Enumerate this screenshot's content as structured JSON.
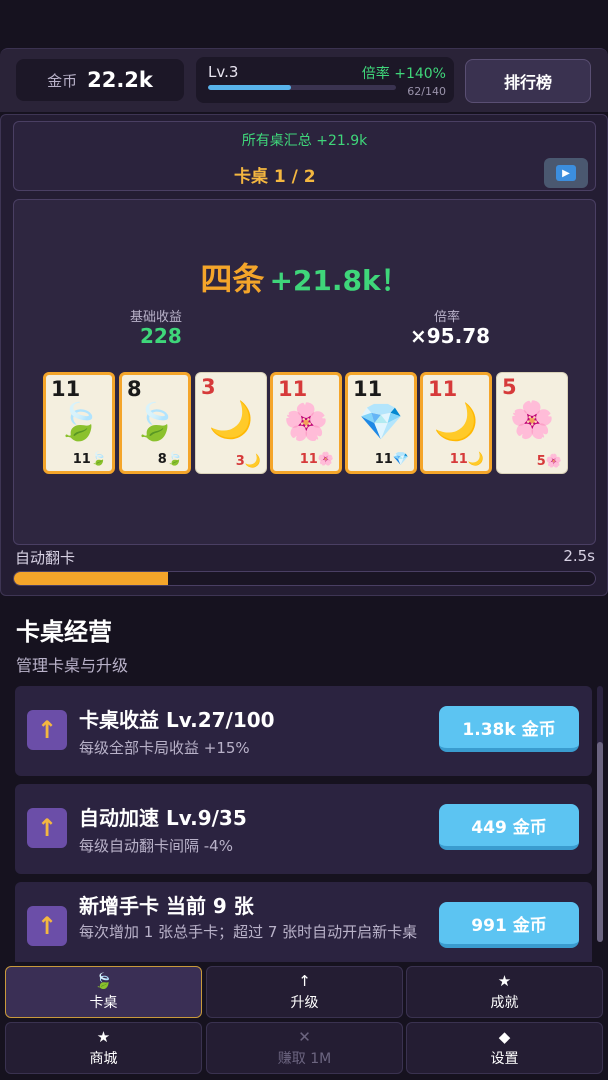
{
  "topbar": {
    "coin_label": "金币",
    "coin_value": "22.2k",
    "level": "Lv.3",
    "rate": "倍率 +140%",
    "xp_text": "62/140",
    "xp_progress": 0.443,
    "rank_label": "排行榜"
  },
  "table": {
    "summary_total": "所有桌汇总  +21.9k",
    "name": "卡桌 1 / 2",
    "play_icon": "play-icon"
  },
  "board": {
    "hand_name": "四条",
    "gain": "+21.8k！",
    "base_label": "基础收益",
    "base_value": "228",
    "mult_label": "倍率",
    "mult_value": "×95.78",
    "cards": [
      {
        "num": "11",
        "icon": "🍃",
        "corner": "11🍃",
        "color": "#1a1a1a",
        "selected": true
      },
      {
        "num": "8",
        "icon": "🍃",
        "corner": "8🍃",
        "color": "#1a1a1a",
        "selected": true
      },
      {
        "num": "3",
        "icon": "🌙",
        "corner": "3🌙",
        "color": "#d63a3a",
        "selected": false
      },
      {
        "num": "11",
        "icon": "🌸",
        "corner": "11🌸",
        "color": "#d63a3a",
        "selected": true
      },
      {
        "num": "11",
        "icon": "💎",
        "corner": "11💎",
        "color": "#1a1a1a",
        "selected": true
      },
      {
        "num": "11",
        "icon": "🌙",
        "corner": "11🌙",
        "color": "#d63a3a",
        "selected": true
      },
      {
        "num": "5",
        "icon": "🌸",
        "corner": "5🌸",
        "color": "#d63a3a",
        "selected": false
      }
    ],
    "auto_label": "自动翻卡",
    "auto_time": "2.5s",
    "auto_progress": 0.265
  },
  "section": {
    "title": "卡桌经营",
    "subtitle": "管理卡桌与升级"
  },
  "upgrades": [
    {
      "title": "卡桌收益  Lv.27/100",
      "desc": "每级全部卡局收益 +15%",
      "cost": "1.38k 金币"
    },
    {
      "title": "自动加速  Lv.9/35",
      "desc": "每级自动翻卡间隔 -4%",
      "cost": "449 金币"
    },
    {
      "title": "新增手卡  当前 9 张",
      "desc": "每次增加 1 张总手卡；超过 7 张时自动开启新卡桌",
      "cost": "991 金币"
    }
  ],
  "nav": [
    {
      "icon": "🍃",
      "label": "卡桌",
      "active": true,
      "disabled": false
    },
    {
      "icon": "↑",
      "label": "升级",
      "active": false,
      "disabled": false
    },
    {
      "icon": "★",
      "label": "成就",
      "active": false,
      "disabled": false
    },
    {
      "icon": "★",
      "label": "商城",
      "active": false,
      "disabled": false
    },
    {
      "icon": "✕",
      "label": "赚取 1M",
      "active": false,
      "disabled": true
    },
    {
      "icon": "◆",
      "label": "设置",
      "active": false,
      "disabled": false
    }
  ]
}
